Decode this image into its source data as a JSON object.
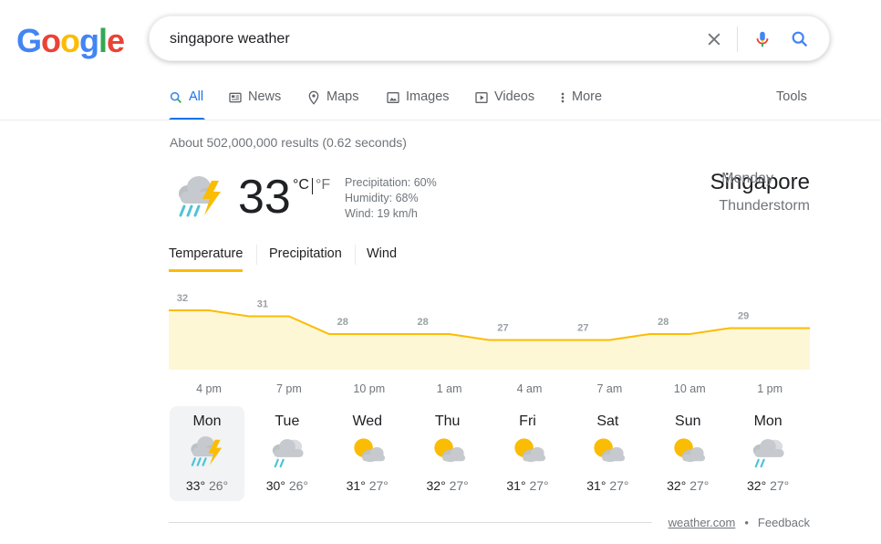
{
  "logo": {
    "letters": [
      "G",
      "o",
      "o",
      "g",
      "l",
      "e"
    ],
    "colors": [
      "#4285f4",
      "#ea4335",
      "#fbbc05",
      "#4285f4",
      "#34a853",
      "#ea4335"
    ]
  },
  "search": {
    "query": "singapore weather",
    "icons": [
      "close-icon",
      "mic-icon",
      "search-icon"
    ]
  },
  "tabs": [
    {
      "label": "All",
      "icon": "search-icon",
      "active": true
    },
    {
      "label": "News",
      "icon": "news-icon"
    },
    {
      "label": "Maps",
      "icon": "map-pin-icon"
    },
    {
      "label": "Images",
      "icon": "image-icon"
    },
    {
      "label": "Videos",
      "icon": "video-icon"
    },
    {
      "label": "More",
      "icon": "more-vert-icon"
    },
    {
      "label": "Tools"
    }
  ],
  "result_stats": "About 502,000,000 results (0.62 seconds)",
  "weather": {
    "temp": "33",
    "unit_c": "°C",
    "unit_f": "°F",
    "precipitation": "Precipitation: 60%",
    "humidity": "Humidity: 68%",
    "wind": "Wind: 19 km/h",
    "location": "Singapore",
    "day": "Monday",
    "condition": "Thunderstorm",
    "condition_icon": "thunderstorm-icon",
    "subtabs": [
      "Temperature",
      "Precipitation",
      "Wind"
    ]
  },
  "chart_data": {
    "type": "area",
    "x": [
      "4 pm",
      "7 pm",
      "10 pm",
      "1 am",
      "4 am",
      "7 am",
      "10 am",
      "1 pm"
    ],
    "values": [
      32,
      31,
      28,
      28,
      27,
      27,
      28,
      29
    ],
    "colors": {
      "line": "#fbbc04",
      "fill": "#fef7d6",
      "labels": "#9aa0a6"
    }
  },
  "forecast": [
    {
      "day": "Mon",
      "hi": "33°",
      "lo": "26°",
      "icon": "thunderstorm-icon",
      "selected": true
    },
    {
      "day": "Tue",
      "hi": "30°",
      "lo": "26°",
      "icon": "rain-cloud-icon"
    },
    {
      "day": "Wed",
      "hi": "31°",
      "lo": "27°",
      "icon": "partly-cloudy-icon"
    },
    {
      "day": "Thu",
      "hi": "32°",
      "lo": "27°",
      "icon": "partly-cloudy-icon"
    },
    {
      "day": "Fri",
      "hi": "31°",
      "lo": "27°",
      "icon": "partly-cloudy-icon"
    },
    {
      "day": "Sat",
      "hi": "31°",
      "lo": "27°",
      "icon": "partly-cloudy-icon"
    },
    {
      "day": "Sun",
      "hi": "32°",
      "lo": "27°",
      "icon": "partly-cloudy-icon"
    },
    {
      "day": "Mon",
      "hi": "32°",
      "lo": "27°",
      "icon": "rain-cloud-icon"
    }
  ],
  "footer": {
    "source": "weather.com",
    "separator": "•",
    "feedback": "Feedback"
  }
}
